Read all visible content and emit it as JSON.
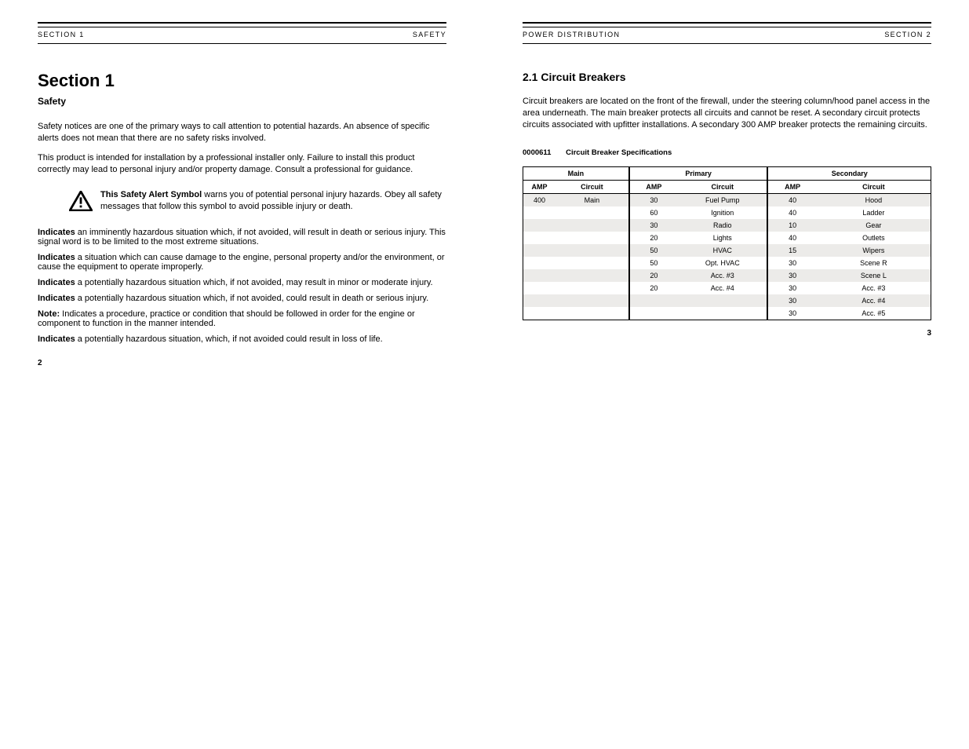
{
  "left": {
    "running": {
      "a": "SECTION 1",
      "b": "SAFETY"
    },
    "title": "Section 1",
    "subtitle": "Safety",
    "intro": "Safety notices are one of the primary ways to call attention to potential hazards. An absence of specific alerts does not mean that there are no safety risks involved.",
    "intro2": "This product is intended for installation by a professional installer only. Failure to install this product correctly may lead to personal injury and/or property damage. Consult a professional for guidance.",
    "callout": {
      "lead": "This Safety Alert Symbol",
      "rest": " warns you of potential personal injury hazards. Obey all safety messages that follow this symbol to avoid possible injury or death."
    },
    "defs": [
      {
        "term": "Indicates",
        "body": " an imminently hazardous situation which, if not avoided, will result in death or serious injury. This signal word is to be limited to the most extreme situations."
      },
      {
        "term": "Indicates",
        "body": " a situation which can cause damage to the engine, personal property and/or the environment, or cause the equipment to operate improperly."
      },
      {
        "term": "Indicates",
        "body": " a potentially hazardous situation which, if not avoided, may result in minor or moderate injury."
      },
      {
        "term": "Indicates",
        "body": " a potentially hazardous situation which, if not avoided, could result in death or serious injury."
      },
      {
        "term": "Note: ",
        "body": "Indicates a procedure, practice or condition that should be followed in order for the engine or component to function in the manner intended."
      },
      {
        "term": "Indicates",
        "body": " a potentially hazardous situation, which, if not avoided could result in loss of life."
      }
    ],
    "pageNumber": "2"
  },
  "right": {
    "running": {
      "a": "POWER DISTRIBUTION",
      "b": "SECTION 2"
    },
    "title": "2.1 Circuit Breakers",
    "intro": "Circuit breakers are located on the front of the firewall, under the steering column/hood panel access in the area underneath. The main breaker protects all circuits and cannot be reset. A secondary circuit protects circuits associated with upfitter installations. A secondary 300 AMP breaker protects the remaining circuits.",
    "tableCaption": {
      "num": "0000611",
      "text": "Circuit Breaker Specifications"
    },
    "table": {
      "groups": [
        "Main",
        "Primary",
        "Secondary"
      ],
      "columns": [
        "AMP",
        "Circuit",
        "AMP",
        "Circuit",
        "AMP",
        "Circuit"
      ],
      "rows": [
        [
          "400",
          "Main",
          "30",
          "Fuel Pump",
          "40",
          "Hood"
        ],
        [
          "",
          "",
          "60",
          "Ignition",
          "40",
          "Ladder"
        ],
        [
          "",
          "",
          "30",
          "Radio",
          "10",
          "Gear"
        ],
        [
          "",
          "",
          "20",
          "Lights",
          "40",
          "Outlets"
        ],
        [
          "",
          "",
          "50",
          "HVAC",
          "15",
          "Wipers"
        ],
        [
          "",
          "",
          "50",
          "Opt. HVAC",
          "30",
          "Scene R"
        ],
        [
          "",
          "",
          "20",
          "Acc. #3",
          "30",
          "Scene L"
        ],
        [
          "",
          "",
          "20",
          "Acc. #4",
          "30",
          "Acc. #3"
        ],
        [
          "",
          "",
          "",
          "",
          "30",
          "Acc. #4"
        ],
        [
          "",
          "",
          "",
          "",
          "30",
          "Acc. #5"
        ]
      ]
    },
    "pageNumber": "3"
  }
}
